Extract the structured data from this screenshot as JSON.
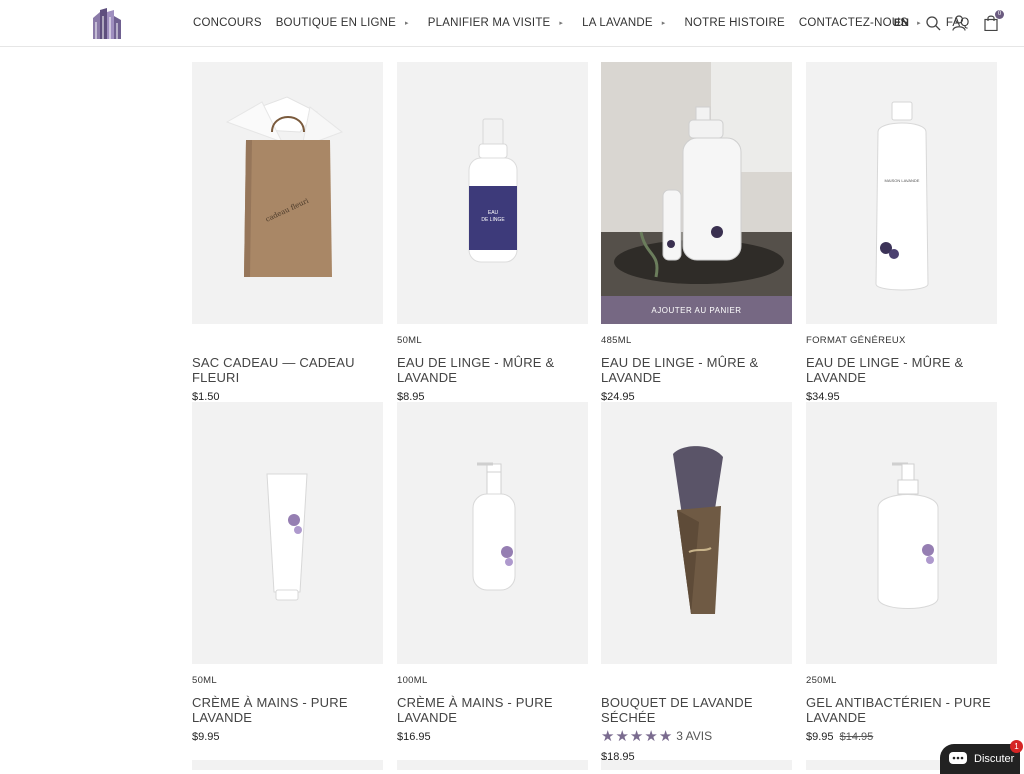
{
  "header": {
    "logo_icon": "maison-lavande-logo",
    "nav": [
      {
        "label": "CONCOURS",
        "has_dropdown": false
      },
      {
        "label": "BOUTIQUE EN LIGNE",
        "has_dropdown": true
      },
      {
        "label": "PLANIFIER MA VISITE",
        "has_dropdown": true
      },
      {
        "label": "LA LAVANDE",
        "has_dropdown": true
      },
      {
        "label": "NOTRE HISTOIRE",
        "has_dropdown": false
      },
      {
        "label": "CONTACTEZ-NOUS",
        "has_dropdown": true
      },
      {
        "label": "FAQ",
        "has_dropdown": false
      }
    ],
    "language": "EN",
    "cart_count": "0"
  },
  "products": [
    {
      "variant": "",
      "title": "SAC CADEAU — CADEAU FLEURI",
      "price": "$1.50",
      "image": "gift-bag"
    },
    {
      "variant": "50ML",
      "title": "EAU DE LINGE - MÛRE & LAVANDE",
      "price": "$8.95",
      "image": "spray-bottle-small"
    },
    {
      "variant": "485ML",
      "title": "EAU DE LINGE - MÛRE & LAVANDE",
      "price": "$24.95",
      "image": "spray-bottle-scene",
      "hover_button": "AJOUTER AU PANIER"
    },
    {
      "variant": "FORMAT GÉNÉREUX",
      "title": "EAU DE LINGE - MÛRE & LAVANDE",
      "price": "$34.95",
      "image": "large-bottle"
    },
    {
      "variant": "50ML",
      "title": "CRÈME À MAINS - PURE LAVANDE",
      "price": "$9.95",
      "image": "hand-cream-tube"
    },
    {
      "variant": "100ML",
      "title": "CRÈME À MAINS - PURE LAVANDE",
      "price": "$16.95",
      "image": "hand-cream-pump"
    },
    {
      "variant": "",
      "title": "BOUQUET DE LAVANDE SÉCHÉE",
      "price": "$18.95",
      "image": "lavender-bouquet",
      "rating": 5,
      "reviews": "3 AVIS"
    },
    {
      "variant": "250ML",
      "title": "GEL ANTIBACTÉRIEN - PURE LAVANDE",
      "price": "$9.95",
      "old_price": "$14.95",
      "image": "pump-bottle"
    }
  ],
  "chat": {
    "label": "Discuter",
    "badge": "1"
  },
  "colors": {
    "accent": "#766883",
    "star": "#7a6b8f",
    "badge": "#d62525"
  }
}
